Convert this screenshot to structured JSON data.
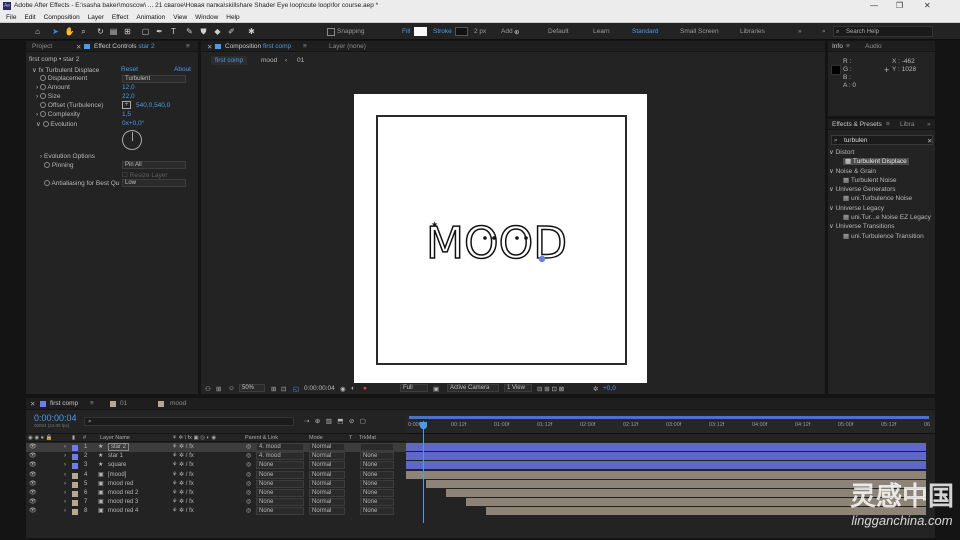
{
  "window": {
    "title": "Adobe After Effects - E:\\sasha baker\\moscow\\ ... 21 свагое\\Новая папка\\skillshare Shader Eye loop\\cute loop\\for course.aep *",
    "app_icon": "Ae",
    "controls": [
      "—",
      "❐",
      "✕"
    ]
  },
  "menu": [
    "File",
    "Edit",
    "Composition",
    "Layer",
    "Effect",
    "Animation",
    "View",
    "Window",
    "Help"
  ],
  "toolbar": {
    "snapping": "Snapping",
    "fill": "Fill",
    "stroke": "Stroke",
    "stroke_px": "2 px",
    "add": "Add",
    "workspaces": [
      "Default",
      "Learn",
      "Standard",
      "Small Screen",
      "Libraries"
    ],
    "active_workspace": "Standard",
    "search_placeholder": "Search Help"
  },
  "left_panel": {
    "tab_project": "Project",
    "tab_effect_controls": "Effect Controls",
    "tab_effect_layer": "star 2",
    "breadcrumb": "first comp • star 2",
    "effect_name": "Turbulent Displace",
    "reset": "Reset",
    "about": "About",
    "props": [
      {
        "name": "Displacement",
        "value": "Turbulent",
        "kind": "dropdown"
      },
      {
        "name": "Amount",
        "value": "12,0",
        "kind": "number"
      },
      {
        "name": "Size",
        "value": "22,0",
        "kind": "number"
      },
      {
        "name": "Offset (Turbulence)",
        "value": "540,0,540,0",
        "kind": "point"
      },
      {
        "name": "Complexity",
        "value": "1,5",
        "kind": "number"
      },
      {
        "name": "Evolution",
        "value": "0x+0,0°",
        "kind": "number"
      }
    ],
    "evolution_options": "Evolution Options",
    "pinning": {
      "name": "Pinning",
      "value": "Pin All"
    },
    "resize_layer": "Resize Layer",
    "antialias": {
      "name": "Antialiasing for Best Qu",
      "value": "Low"
    }
  },
  "viewer": {
    "tab_label": "Composition",
    "tab_comp": "first comp",
    "layer_tab": "Layer (none)",
    "crumbs": [
      "first comp",
      "mood",
      "01"
    ],
    "art_text": "MOOD",
    "zoom": "50%",
    "timecode": "0:00:00:04",
    "resolution": "Full",
    "camera": "Active Camera",
    "views": "1 View",
    "exposure": "+0,0"
  },
  "info_panel": {
    "tab_info": "Info",
    "tab_audio": "Audio",
    "channels": [
      "R :",
      "G :",
      "B :",
      "A : 0"
    ],
    "x": "X : -462",
    "y": "Y : 1028"
  },
  "effects_panel": {
    "tab": "Effects & Presets",
    "tab2": "Libra",
    "query": "turbulen",
    "groups": [
      {
        "name": "Distort",
        "items": [
          "Turbulent Displace"
        ]
      },
      {
        "name": "Noise & Grain",
        "items": [
          "Turbulent Noise"
        ]
      },
      {
        "name": "Universe Generators",
        "items": [
          "uni.Turbulence Noise"
        ]
      },
      {
        "name": "Universe Legacy",
        "items": [
          "uni.Tur...e Noise EZ Legacy"
        ]
      },
      {
        "name": "Universe Transitions",
        "items": [
          "uni.Turbulence Transition"
        ]
      }
    ]
  },
  "timeline": {
    "tabs": [
      "first comp",
      "01",
      "mood"
    ],
    "timecode": "0:00:00:04",
    "frames": "00004 (24.00 fps)",
    "columns": [
      "#",
      "Layer Name",
      "Parent & Link",
      "Mode",
      "T",
      "TrkMat"
    ],
    "layers": [
      {
        "num": "1",
        "icon": "★",
        "name": "star 2",
        "parent": "4. mood",
        "mode": "Normal",
        "trkmat": "",
        "color": "#6d7cf0",
        "selected": true
      },
      {
        "num": "2",
        "icon": "★",
        "name": "star 1",
        "parent": "4. mood",
        "mode": "Normal",
        "trkmat": "None",
        "color": "#6d7cf0",
        "selected": false
      },
      {
        "num": "3",
        "icon": "★",
        "name": "square",
        "parent": "None",
        "mode": "Normal",
        "trkmat": "None",
        "color": "#6d7cf0",
        "selected": false
      },
      {
        "num": "4",
        "icon": "▣",
        "name": "[mood]",
        "parent": "None",
        "mode": "Normal",
        "trkmat": "None",
        "color": "#b7a98f",
        "selected": false
      },
      {
        "num": "5",
        "icon": "▣",
        "name": "mood red",
        "parent": "None",
        "mode": "Normal",
        "trkmat": "None",
        "color": "#b7a98f",
        "selected": false
      },
      {
        "num": "6",
        "icon": "▣",
        "name": "mood red 2",
        "parent": "None",
        "mode": "Normal",
        "trkmat": "None",
        "color": "#b7a98f",
        "selected": false
      },
      {
        "num": "7",
        "icon": "▣",
        "name": "mood red 3",
        "parent": "None",
        "mode": "Normal",
        "trkmat": "None",
        "color": "#b7a98f",
        "selected": false
      },
      {
        "num": "8",
        "icon": "▣",
        "name": "mood red 4",
        "parent": "None",
        "mode": "Normal",
        "trkmat": "None",
        "color": "#b7a98f",
        "selected": false
      }
    ],
    "ruler": [
      "0:00f",
      "00:12f",
      "01:00f",
      "01:12f",
      "02:00f",
      "02:12f",
      "03:00f",
      "03:12f",
      "04:00f",
      "04:12f",
      "05:00f",
      "05:12f",
      "06"
    ]
  },
  "watermark": {
    "title": "灵感中国",
    "url": "lingganchina.com"
  },
  "colors": {
    "accent": "#4a9bea",
    "panel": "#232323",
    "layer_blue": "#6d7cf0",
    "layer_tan": "#b7a98f"
  }
}
